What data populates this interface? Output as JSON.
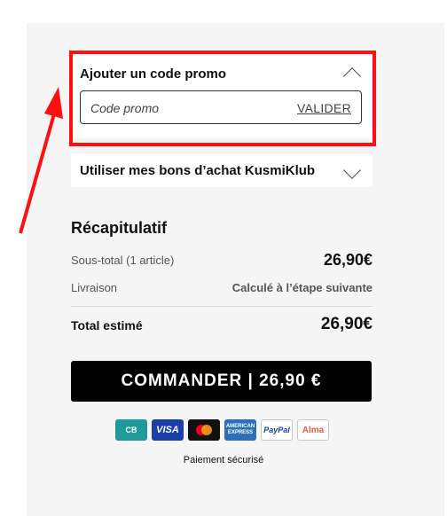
{
  "promo": {
    "title": "Ajouter un code promo",
    "placeholder": "Code promo",
    "submit_label": "VALIDER"
  },
  "bons": {
    "title": "Utiliser mes bons d’achat KusmiKlub"
  },
  "recap": {
    "title": "Récapitulatif",
    "subtotal_label": "Sous-total (1 article)",
    "subtotal_value": "26,90€",
    "shipping_label": "Livraison",
    "shipping_value": "Calculé à l’étape suivante",
    "total_label": "Total estimé",
    "total_value": "26,90€"
  },
  "cta": {
    "label": "COMMANDER | 26,90 €"
  },
  "payments": [
    {
      "name": "CB",
      "icon": "cb-card-icon",
      "bg": "#1f9a9a",
      "fg": "#ffffff"
    },
    {
      "name": "VISA",
      "icon": "visa-card-icon",
      "bg": "#1a3faa",
      "fg": "#ffffff"
    },
    {
      "name": "",
      "icon": "mastercard-icon",
      "bg": "#111111",
      "fg": "#ffffff"
    },
    {
      "name": "AMERICAN EXPRESS",
      "icon": "amex-card-icon",
      "bg": "#2a6fb8",
      "fg": "#ffffff"
    },
    {
      "name": "PayPal",
      "icon": "paypal-icon",
      "bg": "#ffffff",
      "fg": "#1a3faa"
    },
    {
      "name": "Alma",
      "icon": "alma-icon",
      "bg": "#ffffff",
      "fg": "#e55a3a"
    }
  ],
  "secure_text": "Paiement sécurisé",
  "colors": {
    "highlight": "#ff1010",
    "cta_bg": "#000000",
    "panel_bg": "#f5f5f5"
  }
}
